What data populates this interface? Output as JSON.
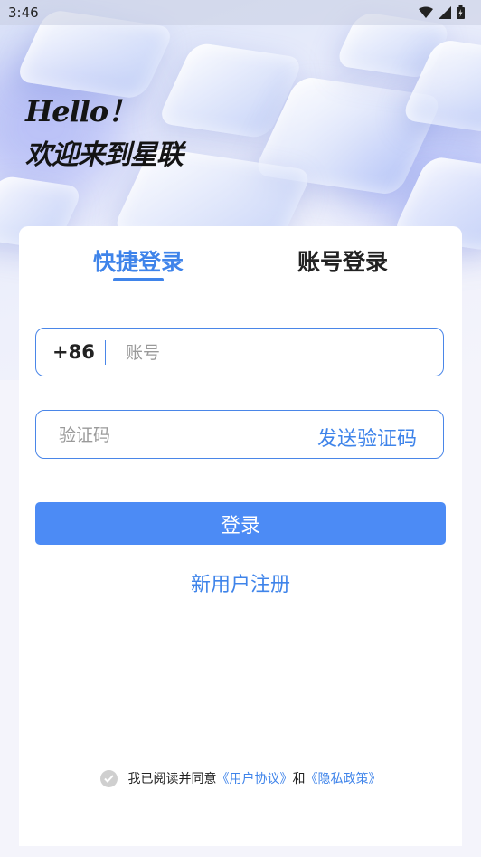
{
  "status_bar": {
    "time": "3:46"
  },
  "greeting": {
    "hello": "Hello！",
    "welcome": "欢迎来到星联"
  },
  "tabs": [
    {
      "label": "快捷登录",
      "active": true
    },
    {
      "label": "账号登录",
      "active": false
    }
  ],
  "phone_field": {
    "country_code": "+86",
    "placeholder": "账号",
    "value": ""
  },
  "code_field": {
    "placeholder": "验证码",
    "value": "",
    "send_label": "发送验证码"
  },
  "login_button": {
    "label": "登录"
  },
  "register_link": {
    "label": "新用户注册"
  },
  "agreement": {
    "prefix": "我已阅读并同意",
    "user_agreement": "《用户协议》",
    "connector": "和",
    "privacy_policy": "《隐私政策》",
    "checked": false
  },
  "colors": {
    "accent": "#3f84ea",
    "button": "#4c8bf5",
    "text": "#222222",
    "placeholder": "#9a9a9a"
  },
  "icons": [
    "wifi-icon",
    "cellular-signal-icon",
    "battery-icon",
    "check-circle-icon"
  ]
}
